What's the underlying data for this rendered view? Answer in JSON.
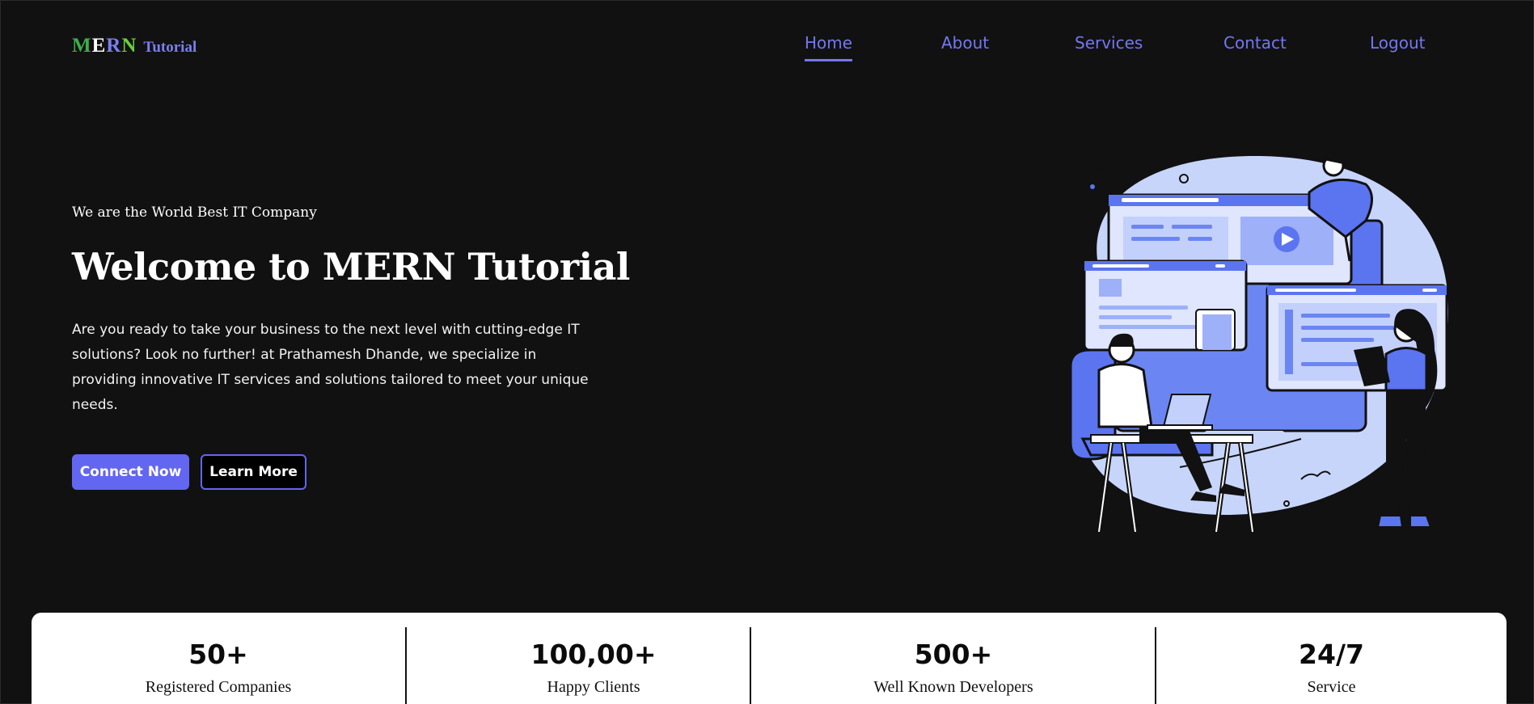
{
  "logo": {
    "m": "M",
    "e": "E",
    "r": "R",
    "n": "N",
    "suffix": "Tutorial"
  },
  "nav": {
    "items": [
      {
        "label": "Home",
        "active": true
      },
      {
        "label": "About",
        "active": false
      },
      {
        "label": "Services",
        "active": false
      },
      {
        "label": "Contact",
        "active": false
      },
      {
        "label": "Logout",
        "active": false
      }
    ]
  },
  "hero": {
    "tagline": "We are the World Best IT Company",
    "title": "Welcome to MERN Tutorial",
    "description": "Are you ready to take your business to the next level with cutting-edge IT solutions? Look no further! at Prathamesh Dhande, we specialize in providing innovative IT services and solutions tailored to meet your unique needs.",
    "primary_button": "Connect Now",
    "secondary_button": "Learn More",
    "illustration_icon": "developers-working-illustration"
  },
  "stats": [
    {
      "value": "50+",
      "label": "Registered Companies"
    },
    {
      "value": "100,00+",
      "label": "Happy Clients"
    },
    {
      "value": "500+",
      "label": "Well Known Developers"
    },
    {
      "value": "24/7",
      "label": "Service"
    }
  ],
  "colors": {
    "background": "#111112",
    "accent": "#6366f1",
    "nav_link": "#7477f0",
    "stats_background": "#ffffff"
  }
}
